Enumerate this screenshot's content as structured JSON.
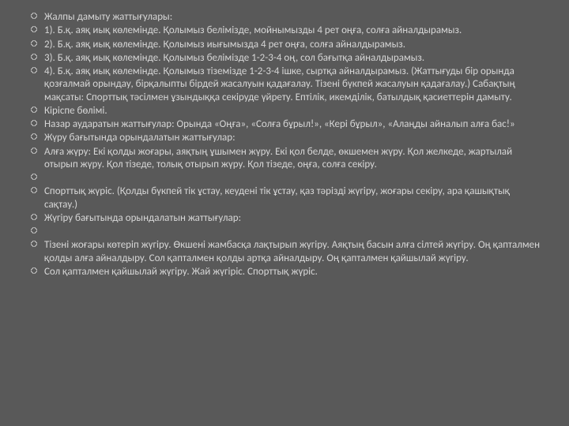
{
  "bullets": [
    "Жалпы дамыту жаттығулары:",
    "1). Б.қ. аяқ иық көлемінде. Қолымыз белімізде, мойнымызды  4 рет оңға, солға айналдырамыз.",
    "2). Б.қ. аяқ иық көлемінде. Қолымыз иығымызда 4 рет  оңға, солға айналдырамыз.",
    "3). Б.қ. аяқ иық көлемінде. Қолымыз белімізде 1-2-3-4 оң, сол бағытқа айналдырамыз.",
    "4). Б.қ. аяқ иық көлемінде. Қолымыз тіземізде 1-2-3-4 ішке, сыртқа айналдырамыз.  (Жаттығуды бір орында қозғалмай орындау,  бірқалыпты бірдей жасалуын қадағалау.  Тізені  бүкпей жасалуын қадағалау.) Сабақтың мақсаты: Спорттық  тәсілмен  ұзындыққа секіруде  үйрету. Ептілік, икемділік, батылдық қасиеттерін дамыту.",
    "Кіріспе бөлімі.",
    "Назар аударатын жаттығулар: Орында «Оңға», «Солға бұрыл!», «Кері бұрыл», «Алаңды айналып алға бас!»",
    "Жүру бағытында орындалатын жаттығулар:",
    "Алға жүру: Екі қолды жоғары, аяқтың ұшымен жүру. Екі қол белде, өкшемен жүру. Қол желкеде, жартылай отырып жүру. Қол тізеде, толық отырып жүру. Қол тізеде, оңға, солға секіру.",
    "",
    "Спорттық жүріс. (Қолды бүкпей тік ұстау, кеудені тік ұстау, қаз тәрізді жүгіру, жоғары секіру, ара қашықтық сақтау.)",
    "Жүгіру бағытында  орындалатын жаттығулар:",
    "",
    "Тізені  жоғары  көтеріп жүгіру.  Өкшені  жамбасқа лақтырып жүгіру.  Аяқтың басын алға сілтей жүгіру.  Оң қапталмен қолды алға айналдыру.  Сол қапталмен  қолды артқа айналдыру.  Оң қапталмен  қайшылай жүгіру.",
    "Сол қапталмен қайшылай жүгіру. Жай жүгіріс.  Спорттық жүріс."
  ]
}
